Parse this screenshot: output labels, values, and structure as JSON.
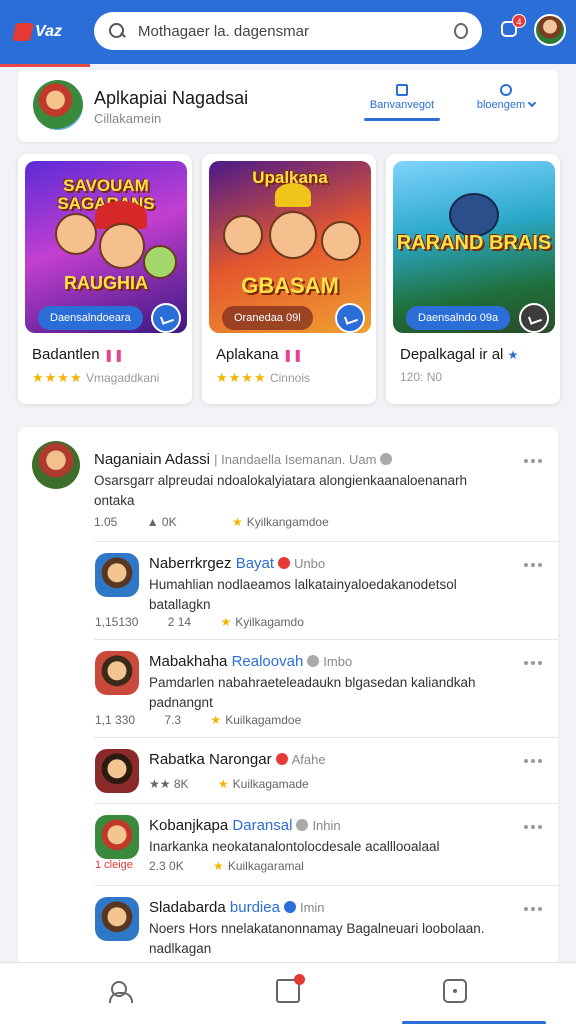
{
  "top_bar": {
    "logo_text": "Vaz",
    "search_text": "Mothagaer la. dagensmar",
    "notification_count": "4",
    "accent_color": "#2c6ed8"
  },
  "header": {
    "title": "Aplkapiai Nagadsai",
    "subtitle": "Cillakamein",
    "tab_active": "Banvanvegot",
    "tab_other": "bloengem"
  },
  "games": [
    {
      "thumb_title": "SAVOUAM SAGARANS",
      "thumb_sub": "RAUGHIA",
      "button": "Daensalndoeara",
      "name": "Badantlen",
      "rating_text": "Vmagaddkani",
      "stars": "★★★★"
    },
    {
      "thumb_title": "Upalkana",
      "thumb_sub": "GBASAM",
      "button": "Oranedaa 09l",
      "name": "Aplakana",
      "rating_text": "Cinnois",
      "stars": "★★★★"
    },
    {
      "thumb_title": "RARAND BRAIS",
      "thumb_sub": "",
      "button": "Daensalndo 09a",
      "name": "Depalkagal ir al",
      "rating_text": "120: N0",
      "stars": ""
    }
  ],
  "feed": [
    {
      "name": "Naganiain Adassi",
      "meta": "Inandaella Isemanan. Uam",
      "text_lines": [
        "Osarsgarr alpreudai ndoalokalyiatara alongienkaanaloenanarh",
        "ontaka"
      ],
      "stat1": "1.05",
      "stat2": "0K",
      "stat3": "Kyilkangamdoe"
    },
    {
      "name": "Naberrkrgez",
      "handle": "Bayat",
      "meta": "Unbo",
      "text_lines": [
        "Humahlian nodlaeamos lalkatainyaloedakanodetsol",
        "batallagkn"
      ],
      "stat1": "1,15130",
      "stat2": "2 14",
      "stat3": "Kyilkagamdo"
    },
    {
      "name": "Mabakhaha",
      "handle": "Realoovah",
      "meta": "Imbo",
      "text_lines": [
        "Pamdarlen nabahraeteleadaukn blgasedan kaliandkah",
        "padnangnt"
      ],
      "stat1": "1,1 330",
      "stat2": "7.3",
      "stat3": "Kuilkagamdoe"
    },
    {
      "name": "Rabatka Narongar",
      "handle": "",
      "meta": "Afahe",
      "text_lines": [],
      "stat1": "★★ 8K",
      "stat2": "",
      "stat3": "Kuilkagamade"
    },
    {
      "name": "Kobanjkapa",
      "handle": "Daransal",
      "meta": "Inhin",
      "text_lines": [
        "Inarkanka neokatanalontolocdesale acalllooalaal"
      ],
      "stat1": "2.3 0K",
      "stat2": "",
      "stat3": "Kuilkagaramal",
      "avatar_label": "1 cleige"
    },
    {
      "name": "Sladabarda",
      "handle": "burdiea",
      "meta": "Imin",
      "text_lines": [
        "Noers Hors nnelakatanonnamay Bagalneuari loobolaan.",
        "nadlkagan"
      ],
      "stat1": "",
      "stat2": "",
      "stat3": ""
    }
  ]
}
